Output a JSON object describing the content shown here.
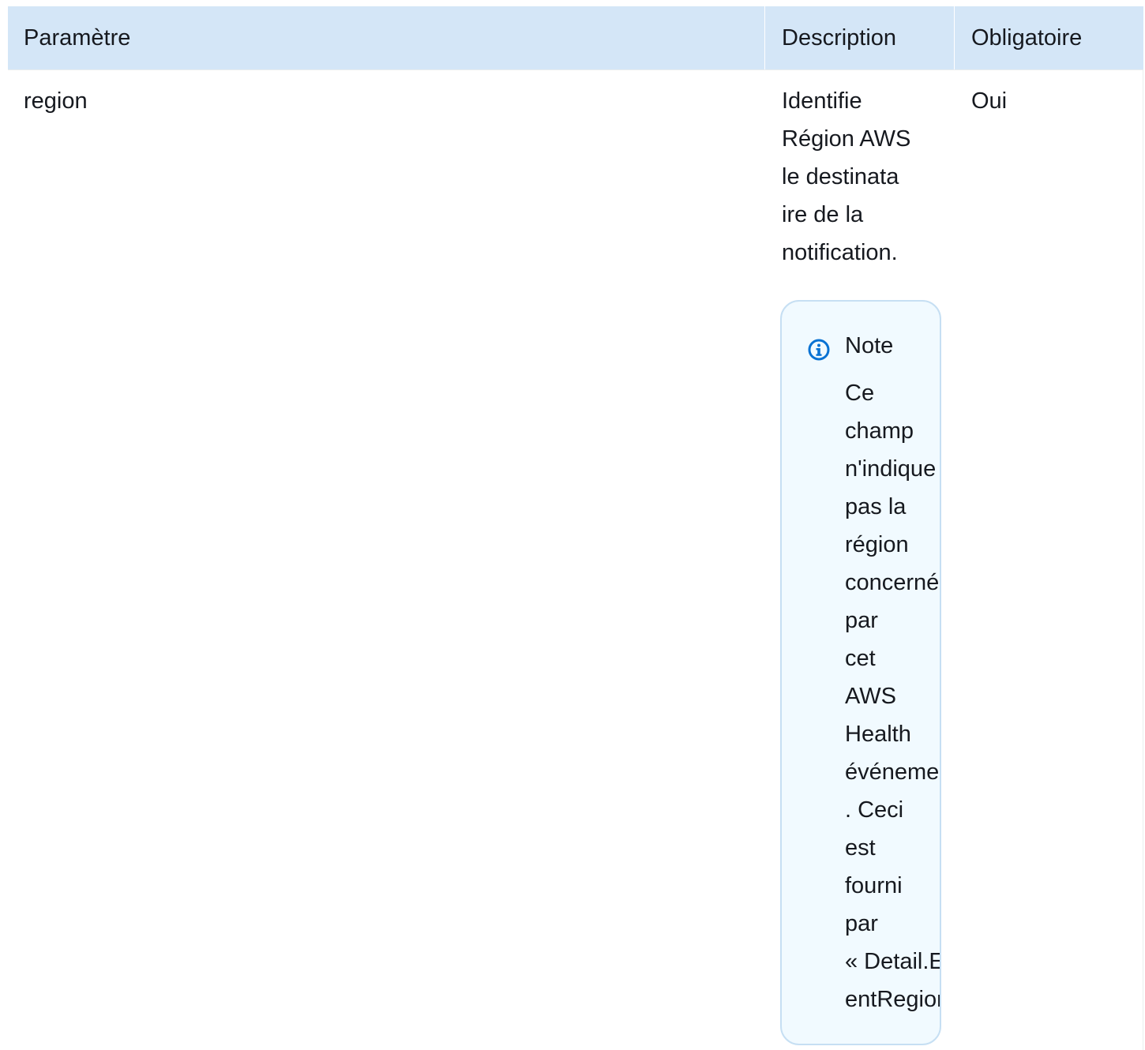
{
  "table": {
    "headers": {
      "parameter": "Paramètre",
      "description": "Description",
      "required": "Obligatoire"
    },
    "rows": [
      {
        "parameter": "region",
        "description_lines": [
          "Identifie",
          "Région AWS",
          "le destinata",
          "ire de la",
          "notification."
        ],
        "note": {
          "title": "Note",
          "icon": "info-icon",
          "lines": [
            "Ce",
            "champ",
            "n'indique",
            "pas la",
            "région",
            "concernée",
            "par",
            "cet",
            "AWS",
            "Health",
            "événement",
            ". Ceci",
            "est",
            "fourni",
            "par",
            "« Detail.Ev",
            "entRegion"
          ]
        },
        "required": "Oui"
      }
    ]
  },
  "colors": {
    "header_bg": "#d4e6f7",
    "note_bg": "#f1faff",
    "note_border": "#c6dff3",
    "info_icon": "#0972d3"
  }
}
